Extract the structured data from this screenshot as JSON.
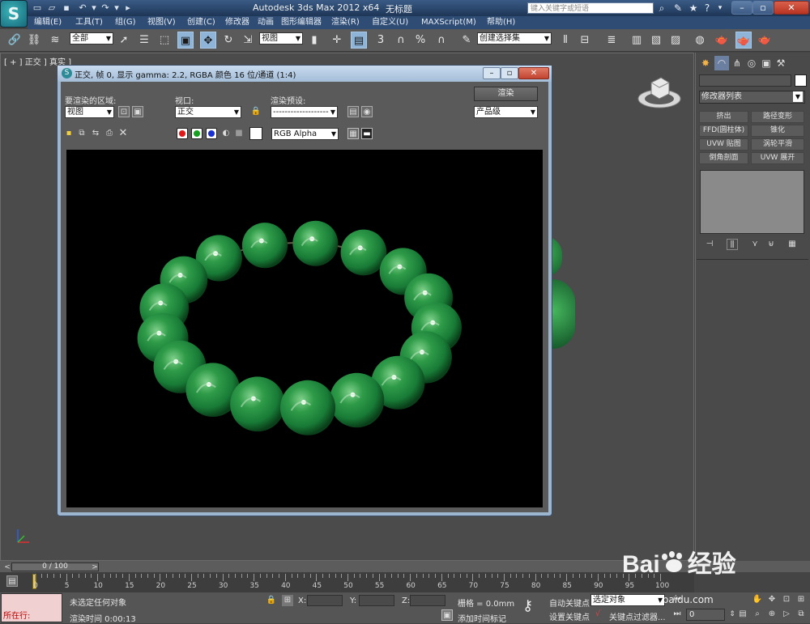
{
  "app": {
    "title": "Autodesk 3ds Max  2012 x64",
    "document": "无标题",
    "logo_text": "S",
    "help_search_placeholder": "键入关键字或短语"
  },
  "menus": [
    "编辑(E)",
    "工具(T)",
    "组(G)",
    "视图(V)",
    "创建(C)",
    "修改器",
    "动画",
    "图形编辑器",
    "渲染(R)",
    "自定义(U)",
    "MAXScript(M)",
    "帮助(H)"
  ],
  "toolbar": {
    "selection_filter": "全部",
    "ref_coord": "视图",
    "named_selection": "创建选择集"
  },
  "viewport": {
    "label": "[ + ] 正交 ] 真实 ]"
  },
  "render_window": {
    "title": "正交, 帧 0, 显示 gamma: 2.2, RGBA 颜色 16 位/通道 (1:4)",
    "area_label": "要渲染的区域:",
    "area_value": "视图",
    "viewport_label": "视口:",
    "viewport_value": "正交",
    "preset_label": "渲染预设:",
    "preset_value": "-------------------",
    "render_button": "渲染",
    "production_value": "产品级",
    "channel_value": "RGB Alpha",
    "colors": {
      "red": "#e01818",
      "green": "#16a020",
      "blue": "#1830d0"
    }
  },
  "command_panel": {
    "modifier_list": "修改器列表",
    "buttons": [
      "挤出",
      "路径变形",
      "FFD(圆柱体)",
      "锥化",
      "UVW 贴图",
      "涡轮平滑",
      "倒角剖面",
      "UVW 展开"
    ]
  },
  "timeline": {
    "frame_display": "0 / 100",
    "ticks": [
      "0",
      "5",
      "10",
      "15",
      "20",
      "25",
      "30",
      "35",
      "40",
      "45",
      "50",
      "55",
      "60",
      "65",
      "70",
      "75",
      "80",
      "85",
      "90",
      "95",
      "100"
    ]
  },
  "status": {
    "mini_listener": "所在行:",
    "selection_status": "未选定任何对象",
    "render_time": "渲染时间  0:00:13",
    "x_label": "X:",
    "y_label": "Y:",
    "z_label": "Z:",
    "grid": "栅格 = 0.0mm",
    "add_time_tag": "添加时间标记",
    "auto_key": "自动关键点",
    "set_key": "设置关键点",
    "key_mode": "选定对象",
    "key_filters": "关键点过滤器...",
    "frame_value": "0"
  },
  "watermark": {
    "brand": "Bai",
    "brand2": "经验",
    "site": "jingyan.baidu.com"
  }
}
